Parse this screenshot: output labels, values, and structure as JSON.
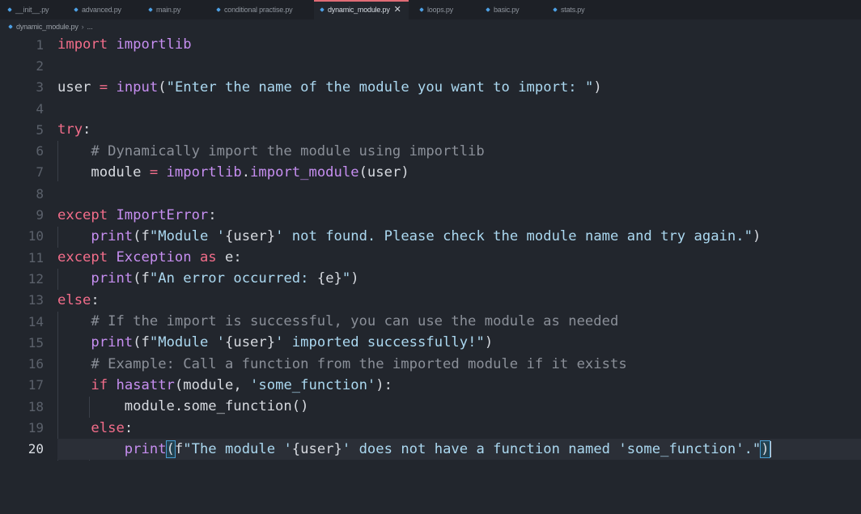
{
  "tabs": [
    {
      "label": "__init__.py",
      "active": false
    },
    {
      "label": "advanced.py",
      "active": false
    },
    {
      "label": "main.py",
      "active": false
    },
    {
      "label": "conditional practise.py",
      "active": false
    },
    {
      "label": "dynamic_module.py",
      "active": true
    },
    {
      "label": "loops.py",
      "active": false
    },
    {
      "label": "basic.py",
      "active": false
    },
    {
      "label": "stats.py",
      "active": false
    }
  ],
  "breadcrumb": {
    "file": "dynamic_module.py",
    "more": "..."
  },
  "line_numbers": [
    "1",
    "2",
    "3",
    "4",
    "5",
    "6",
    "7",
    "8",
    "9",
    "10",
    "11",
    "12",
    "13",
    "14",
    "15",
    "16",
    "17",
    "18",
    "19",
    "20"
  ],
  "current_line": 20,
  "code": {
    "l1": [
      "import",
      " ",
      "importlib"
    ],
    "l3": [
      "user",
      " ",
      "=",
      " ",
      "input",
      "(",
      "\"Enter the name of the module you want to import: \"",
      ")"
    ],
    "l5": [
      "try",
      ":"
    ],
    "l6": [
      "    ",
      "# Dynamically import the module using importlib"
    ],
    "l7": [
      "    module ",
      "=",
      " ",
      "importlib",
      ".",
      "import_module",
      "(user)"
    ],
    "l9": [
      "except",
      " ",
      "ImportError",
      ":"
    ],
    "l10": [
      "    ",
      "print",
      "(",
      "f",
      "\"Module '",
      "{user}",
      "' not found. Please check the module name and try again.\"",
      ")"
    ],
    "l11": [
      "except",
      " ",
      "Exception",
      " ",
      "as",
      " e:"
    ],
    "l12": [
      "    ",
      "print",
      "(",
      "f",
      "\"An error occurred: ",
      "{e}",
      "\"",
      ")"
    ],
    "l13": [
      "else",
      ":"
    ],
    "l14": [
      "    ",
      "# If the import is successful, you can use the module as needed"
    ],
    "l15": [
      "    ",
      "print",
      "(",
      "f",
      "\"Module '",
      "{user}",
      "' imported successfully!\"",
      ")"
    ],
    "l16": [
      "    ",
      "# Example: Call a function from the imported module if it exists"
    ],
    "l17": [
      "    ",
      "if",
      " ",
      "hasattr",
      "(module, ",
      "'some_function'",
      "):"
    ],
    "l18": [
      "        module.some_function",
      "()"
    ],
    "l19": [
      "    ",
      "else",
      ":"
    ],
    "l20": [
      "        ",
      "print",
      "(",
      "f",
      "\"The module '",
      "{user}",
      "' does not have a function named 'some_function'.\"",
      ")"
    ]
  },
  "colors": {
    "keyword": "#f26d8a",
    "function": "#c68ef0",
    "string": "#abd8f0",
    "comment": "#8a8f98",
    "background": "#22262d",
    "active_tab_accent": "#e06c75"
  },
  "icons": {
    "tab_file": "python-file-icon",
    "close": "close-icon"
  }
}
